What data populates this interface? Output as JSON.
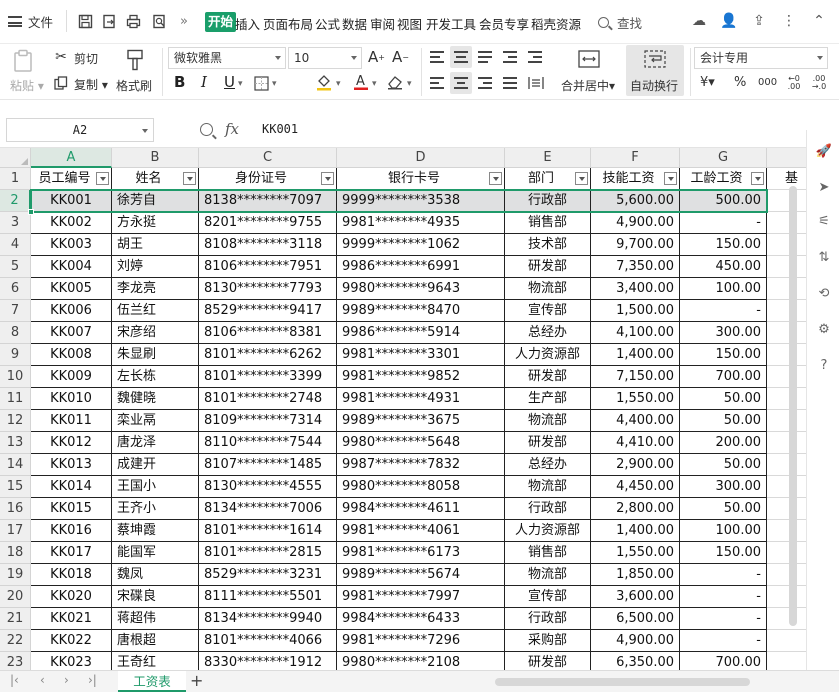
{
  "menubar": {
    "file_label": "文件",
    "tabs": [
      "开始",
      "插入",
      "页面布局",
      "公式",
      "数据",
      "审阅",
      "视图",
      "开发工具",
      "会员专享",
      "稻壳资源"
    ],
    "search_label": "查找"
  },
  "ribbon": {
    "paste": "粘贴",
    "cut": "剪切",
    "copy": "复制",
    "format_painter": "格式刷",
    "font_name": "微软雅黑",
    "font_size": "10",
    "bold": "B",
    "italic": "I",
    "underline": "U",
    "merge_center": "合并居中",
    "wrap_text": "自动换行",
    "number_format": "会计专用",
    "currency_symbol": "¥",
    "percent_symbol": "%",
    "thousands": "000"
  },
  "formula_bar": {
    "cell_ref": "A2",
    "fx": "fx",
    "content": "KK001"
  },
  "columns": [
    "A",
    "B",
    "C",
    "D",
    "E",
    "F",
    "G"
  ],
  "table": {
    "headers": [
      "员工编号",
      "姓名",
      "身份证号",
      "银行卡号",
      "部门",
      "技能工资",
      "工龄工资",
      "基"
    ],
    "rows": [
      [
        "KK001",
        "徐芳自",
        "8138********7097",
        "9999********3538",
        "行政部",
        "5,600.00",
        "500.00"
      ],
      [
        "KK002",
        "方永挺",
        "8201********9755",
        "9981********4935",
        "销售部",
        "4,900.00",
        "-"
      ],
      [
        "KK003",
        "胡王",
        "8108********3118",
        "9999********1062",
        "技术部",
        "9,700.00",
        "150.00"
      ],
      [
        "KK004",
        "刘婷",
        "8106********7951",
        "9986********6991",
        "研发部",
        "7,350.00",
        "450.00"
      ],
      [
        "KK005",
        "李龙亮",
        "8130********7793",
        "9980********9643",
        "物流部",
        "3,400.00",
        "100.00"
      ],
      [
        "KK006",
        "伍兰红",
        "8529********9417",
        "9989********8470",
        "宣传部",
        "1,500.00",
        "-"
      ],
      [
        "KK007",
        "宋彦绍",
        "8106********8381",
        "9986********5914",
        "总经办",
        "4,100.00",
        "300.00"
      ],
      [
        "KK008",
        "朱显刷",
        "8101********6262",
        "9981********3301",
        "人力资源部",
        "1,400.00",
        "150.00"
      ],
      [
        "KK009",
        "左长栋",
        "8101********3399",
        "9981********9852",
        "研发部",
        "7,150.00",
        "700.00"
      ],
      [
        "KK010",
        "魏健晓",
        "8101********2748",
        "9981********4931",
        "生产部",
        "1,550.00",
        "50.00"
      ],
      [
        "KK011",
        "栾业鬲",
        "8109********7314",
        "9989********3675",
        "物流部",
        "4,400.00",
        "50.00"
      ],
      [
        "KK012",
        "唐龙泽",
        "8110********7544",
        "9980********5648",
        "研发部",
        "4,410.00",
        "200.00"
      ],
      [
        "KK013",
        "成建开",
        "8107********1485",
        "9987********7832",
        "总经办",
        "2,900.00",
        "50.00"
      ],
      [
        "KK014",
        "王国小",
        "8130********4555",
        "9980********8058",
        "物流部",
        "4,450.00",
        "300.00"
      ],
      [
        "KK015",
        "王齐小",
        "8134********7006",
        "9984********4611",
        "行政部",
        "2,800.00",
        "50.00"
      ],
      [
        "KK016",
        "蔡坤霞",
        "8101********1614",
        "9981********4061",
        "人力资源部",
        "1,400.00",
        "100.00"
      ],
      [
        "KK017",
        "能国军",
        "8101********2815",
        "9981********6173",
        "销售部",
        "1,550.00",
        "150.00"
      ],
      [
        "KK018",
        "魏凤",
        "8529********3231",
        "9989********5674",
        "物流部",
        "1,850.00",
        "-"
      ],
      [
        "KK020",
        "宋碟良",
        "8111********5501",
        "9981********7997",
        "宣传部",
        "3,600.00",
        "-"
      ],
      [
        "KK021",
        "蒋超伟",
        "8134********9940",
        "9984********6433",
        "行政部",
        "6,500.00",
        "-"
      ],
      [
        "KK022",
        "唐根超",
        "8101********4066",
        "9981********7296",
        "采购部",
        "4,900.00",
        "-"
      ],
      [
        "KK023",
        "王奇红",
        "8330********1912",
        "9980********2108",
        "研发部",
        "6,350.00",
        "700.00"
      ]
    ]
  },
  "sheet_tabs": {
    "active": "工资表",
    "add": "+"
  },
  "colors": {
    "accent": "#1f9a6a",
    "selected_row": "#dfe0e1",
    "header_bg": "#efefef"
  }
}
